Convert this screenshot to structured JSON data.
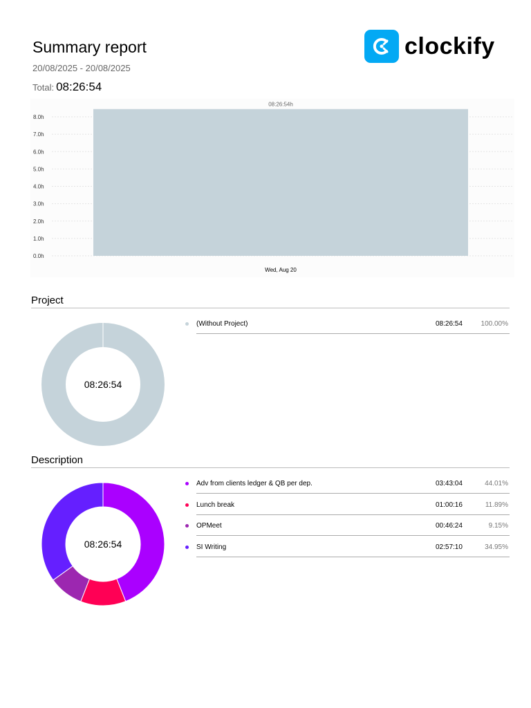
{
  "header": {
    "title": "Summary report",
    "date_range": "20/08/2025 - 20/08/2025",
    "total_label": "Total:",
    "total_value": "08:26:54",
    "logo_text": "clockify"
  },
  "chart_data": {
    "type": "bar",
    "categories": [
      "Wed, Aug 20"
    ],
    "values": [
      8.448
    ],
    "data_labels": [
      "08:26:54h"
    ],
    "yticks": [
      "0.0h",
      "1.0h",
      "2.0h",
      "3.0h",
      "4.0h",
      "5.0h",
      "6.0h",
      "7.0h",
      "8.0h"
    ],
    "ylim": [
      0,
      8
    ],
    "bar_color": "#c5d3da",
    "grid": true
  },
  "project": {
    "heading": "Project",
    "center": "08:26:54",
    "items": [
      {
        "label": "(Without Project)",
        "duration": "08:26:54",
        "percent": "100.00%",
        "value": 100,
        "color": "#c5d3da"
      }
    ]
  },
  "description": {
    "heading": "Description",
    "center": "08:26:54",
    "items": [
      {
        "label": "Adv from clients ledger & QB per dep.",
        "duration": "03:43:04",
        "percent": "44.01%",
        "value": 44.01,
        "color": "#aa00ff"
      },
      {
        "label": "Lunch break",
        "duration": "01:00:16",
        "percent": "11.89%",
        "value": 11.89,
        "color": "#ff0055"
      },
      {
        "label": "OPMeet",
        "duration": "00:46:24",
        "percent": "9.15%",
        "value": 9.15,
        "color": "#9c27b0"
      },
      {
        "label": "SI Writing",
        "duration": "02:57:10",
        "percent": "34.95%",
        "value": 34.95,
        "color": "#651fff"
      }
    ]
  }
}
